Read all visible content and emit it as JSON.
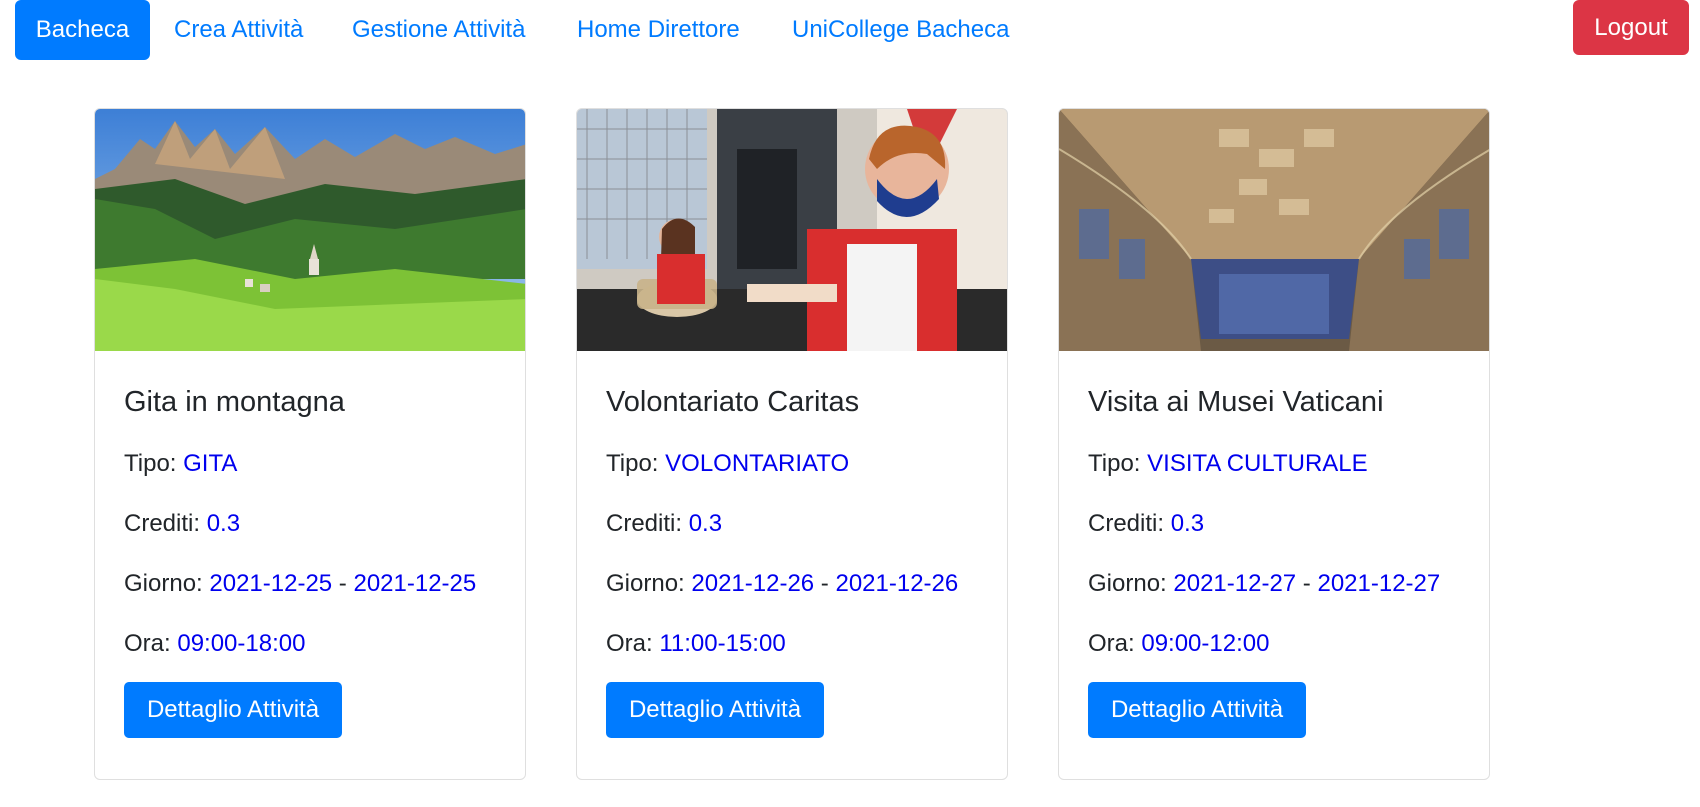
{
  "nav": {
    "items": [
      {
        "label": "Bacheca",
        "active": true
      },
      {
        "label": "Crea Attività"
      },
      {
        "label": "Gestione Attività"
      },
      {
        "label": "Home Direttore"
      },
      {
        "label": "UniCollege Bacheca"
      }
    ],
    "logout": "Logout"
  },
  "labels": {
    "tipo": "Tipo: ",
    "crediti": "Crediti: ",
    "giorno": "Giorno: ",
    "ora": "Ora: ",
    "sep": " - "
  },
  "cards": [
    {
      "title": "Gita in montagna",
      "tipo": "GITA",
      "crediti": "0.3",
      "giorno_da": "2021-12-25",
      "giorno_a": "2021-12-25",
      "ora": "09:00-18:00",
      "button": "Dettaglio Attività"
    },
    {
      "title": "Volontariato Caritas",
      "tipo": "VOLONTARIATO",
      "crediti": "0.3",
      "giorno_da": "2021-12-26",
      "giorno_a": "2021-12-26",
      "ora": "11:00-15:00",
      "button": "Dettaglio Attività"
    },
    {
      "title": "Visita ai Musei Vaticani",
      "tipo": "VISITA CULTURALE",
      "crediti": "0.3",
      "giorno_da": "2021-12-27",
      "giorno_a": "2021-12-27",
      "ora": "09:00-12:00",
      "button": "Dettaglio Attività"
    }
  ],
  "colors": {
    "primary": "#007bff",
    "danger": "#dc3545",
    "value_text": "#0000ee"
  }
}
